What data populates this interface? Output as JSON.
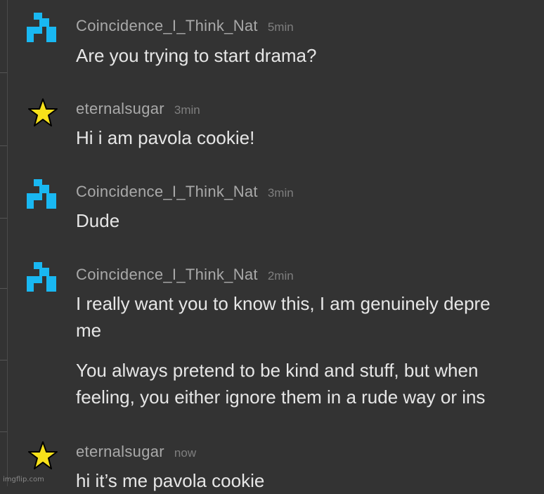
{
  "icons": {
    "blue_avatar": "blue-block-icon",
    "star_avatar": "star-icon"
  },
  "colors": {
    "background": "#333333",
    "blue_avatar": "#19b8f2",
    "star_fill": "#f7e11a",
    "username": "#a9a9a9",
    "timestamp": "#7f7f7f",
    "message_text": "#e6e6e6"
  },
  "messages": [
    {
      "username": "Coincidence_I_Think_Nat",
      "time": "5min",
      "lines": [
        "Are you trying to start drama?"
      ]
    },
    {
      "username": "eternalsugar",
      "time": "3min",
      "lines": [
        "Hi i am pavola cookie!"
      ]
    },
    {
      "username": "Coincidence_I_Think_Nat",
      "time": "3min",
      "lines": [
        "Dude"
      ]
    },
    {
      "username": "Coincidence_I_Think_Nat",
      "time": "2min",
      "lines": [
        "I really want you to know this, I am genuinely depre",
        "me",
        "You always pretend to be kind and stuff, but when",
        "feeling, you either ignore them in a rude way or ins"
      ]
    },
    {
      "username": "eternalsugar",
      "time": "now",
      "lines": [
        "hi it’s me pavola cookie"
      ]
    }
  ],
  "watermark": "imgflip.com"
}
